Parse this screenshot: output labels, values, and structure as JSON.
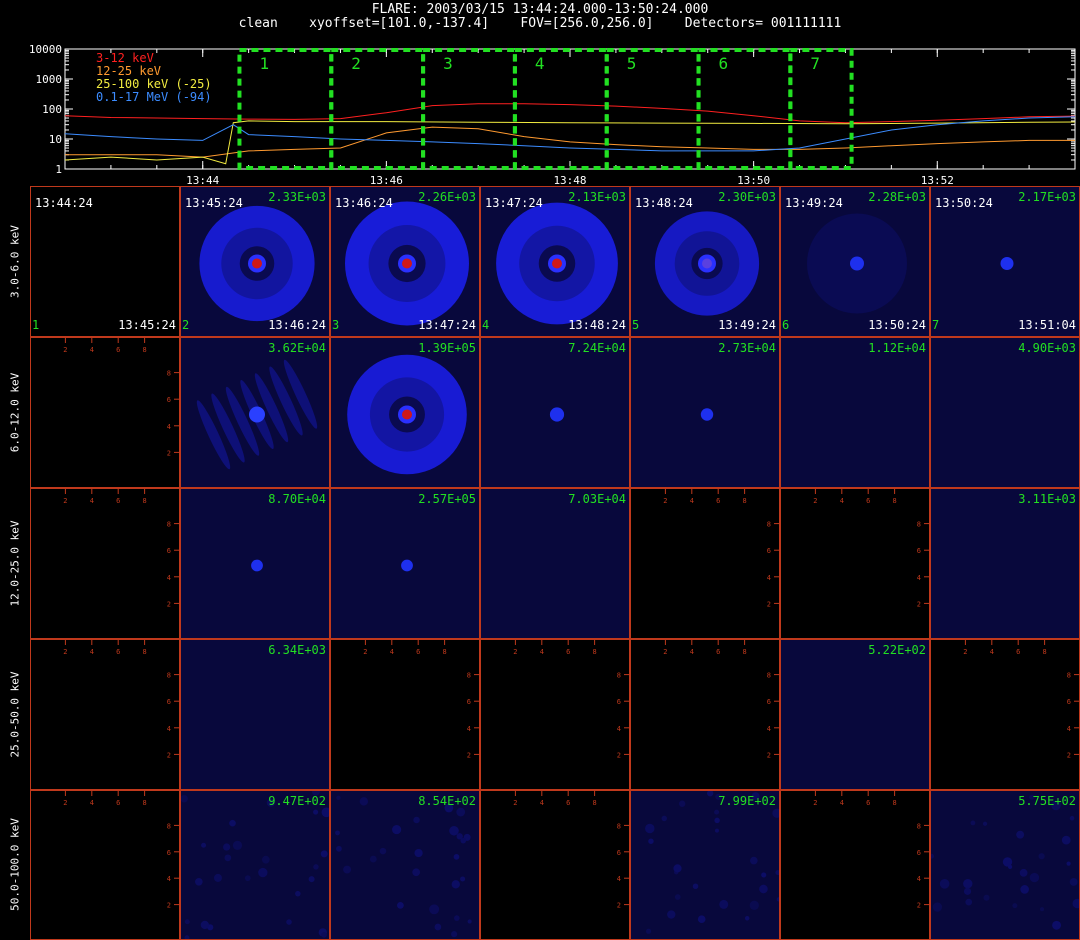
{
  "header": {
    "line1": "FLARE: 2003/03/15 13:44:24.000-13:50:24.000",
    "line2": "clean    xyoffset=[101.0,-137.4]    FOV=[256.0,256.0]    Detectors= 001111111"
  },
  "chart_data": [
    {
      "type": "line",
      "y_scale": "log",
      "ylim": [
        1,
        10000
      ],
      "y_tick_labels": [
        "1",
        "10",
        "100",
        "1000",
        "10000"
      ],
      "x_tick_labels": [
        "13:44",
        "13:46",
        "13:48",
        "13:50",
        "13:52"
      ],
      "x_range_minutes": [
        "13:42:30",
        "13:53:30"
      ],
      "legend": [
        {
          "label": "3-12 keV",
          "color": "#ff2020"
        },
        {
          "label": "12-25 keV",
          "color": "#ff9a30"
        },
        {
          "label": "25-100 keV (-25)",
          "color": "#f2ec40"
        },
        {
          "label": "0.1-17 MeV (-94)",
          "color": "#3c8cff"
        }
      ],
      "series": [
        {
          "name": "3-12 keV",
          "color": "#ff2020",
          "points": [
            [
              "13:42:30",
              60
            ],
            [
              "13:43:00",
              52
            ],
            [
              "13:43:30",
              50
            ],
            [
              "13:44:00",
              48
            ],
            [
              "13:44:30",
              46
            ],
            [
              "13:45:00",
              45
            ],
            [
              "13:45:30",
              48
            ],
            [
              "13:46:00",
              75
            ],
            [
              "13:46:30",
              130
            ],
            [
              "13:47:00",
              150
            ],
            [
              "13:47:30",
              150
            ],
            [
              "13:48:00",
              140
            ],
            [
              "13:48:30",
              125
            ],
            [
              "13:49:00",
              105
            ],
            [
              "13:49:30",
              85
            ],
            [
              "13:50:00",
              60
            ],
            [
              "13:50:30",
              40
            ],
            [
              "13:51:00",
              35
            ],
            [
              "13:51:30",
              38
            ],
            [
              "13:52:00",
              42
            ],
            [
              "13:52:30",
              48
            ],
            [
              "13:53:00",
              55
            ],
            [
              "13:53:30",
              58
            ]
          ]
        },
        {
          "name": "12-25 keV",
          "color": "#ff9a30",
          "points": [
            [
              "13:42:30",
              3
            ],
            [
              "13:43:00",
              3
            ],
            [
              "13:43:30",
              3
            ],
            [
              "13:44:00",
              2.5
            ],
            [
              "13:44:30",
              4
            ],
            [
              "13:45:00",
              4.5
            ],
            [
              "13:45:30",
              5
            ],
            [
              "13:46:00",
              16
            ],
            [
              "13:46:30",
              25
            ],
            [
              "13:47:00",
              22
            ],
            [
              "13:47:30",
              12
            ],
            [
              "13:48:00",
              8
            ],
            [
              "13:48:30",
              6.5
            ],
            [
              "13:49:00",
              5.5
            ],
            [
              "13:49:30",
              5
            ],
            [
              "13:50:00",
              4.5
            ],
            [
              "13:50:30",
              4.5
            ],
            [
              "13:51:00",
              5
            ],
            [
              "13:51:30",
              6
            ],
            [
              "13:52:00",
              7
            ],
            [
              "13:52:30",
              8
            ],
            [
              "13:53:00",
              9
            ],
            [
              "13:53:30",
              9
            ]
          ]
        },
        {
          "name": "25-100 keV (-25)",
          "color": "#f2ec40",
          "points": [
            [
              "13:42:30",
              2
            ],
            [
              "13:43:00",
              2.5
            ],
            [
              "13:43:30",
              2
            ],
            [
              "13:44:00",
              2.5
            ],
            [
              "13:44:15",
              1.5
            ],
            [
              "13:44:20",
              35
            ],
            [
              "13:44:30",
              40
            ],
            [
              "13:45:00",
              38
            ],
            [
              "13:46:00",
              38
            ],
            [
              "13:47:00",
              36
            ],
            [
              "13:48:00",
              35
            ],
            [
              "13:49:00",
              34
            ],
            [
              "13:50:00",
              33
            ],
            [
              "13:51:00",
              32
            ],
            [
              "13:52:00",
              34
            ],
            [
              "13:53:00",
              36
            ],
            [
              "13:53:30",
              37
            ]
          ]
        },
        {
          "name": "0.1-17 MeV (-94)",
          "color": "#3c8cff",
          "points": [
            [
              "13:42:30",
              15
            ],
            [
              "13:43:00",
              12
            ],
            [
              "13:43:30",
              10
            ],
            [
              "13:44:00",
              9
            ],
            [
              "13:44:20",
              30
            ],
            [
              "13:44:30",
              14
            ],
            [
              "13:45:00",
              12
            ],
            [
              "13:45:30",
              10
            ],
            [
              "13:46:00",
              9
            ],
            [
              "13:46:30",
              8
            ],
            [
              "13:47:00",
              7
            ],
            [
              "13:47:30",
              6
            ],
            [
              "13:48:00",
              5
            ],
            [
              "13:48:30",
              4.5
            ],
            [
              "13:49:00",
              4
            ],
            [
              "13:49:30",
              4
            ],
            [
              "13:50:00",
              4
            ],
            [
              "13:50:30",
              5
            ],
            [
              "13:51:00",
              10
            ],
            [
              "13:51:30",
              20
            ],
            [
              "13:52:00",
              30
            ],
            [
              "13:52:30",
              40
            ],
            [
              "13:53:00",
              50
            ],
            [
              "13:53:30",
              55
            ]
          ]
        }
      ],
      "intervals": [
        {
          "label": "1",
          "start": "13:44:24",
          "end": "13:45:24"
        },
        {
          "label": "2",
          "start": "13:45:24",
          "end": "13:46:24"
        },
        {
          "label": "3",
          "start": "13:46:24",
          "end": "13:47:24"
        },
        {
          "label": "4",
          "start": "13:47:24",
          "end": "13:48:24"
        },
        {
          "label": "5",
          "start": "13:48:24",
          "end": "13:49:24"
        },
        {
          "label": "6",
          "start": "13:49:24",
          "end": "13:50:24"
        },
        {
          "label": "7",
          "start": "13:50:24",
          "end": "13:51:04"
        }
      ]
    },
    {
      "type": "heatmap",
      "row_labels": [
        "3.0-6.0 keV",
        "6.0-12.0 keV",
        "12.0-25.0 keV",
        "25.0-50.0 keV",
        "50.0-100.0 keV"
      ],
      "column_start_times": [
        "13:44:24",
        "13:45:24",
        "13:46:24",
        "13:47:24",
        "13:48:24",
        "13:49:24",
        "13:50:24"
      ],
      "column_end_times": [
        "13:45:24",
        "13:46:24",
        "13:47:24",
        "13:48:24",
        "13:49:24",
        "13:50:24",
        "13:51:04"
      ],
      "column_index_labels": [
        "1",
        "2",
        "3",
        "4",
        "5",
        "6",
        "7"
      ],
      "empty_axis_tick_labels": [
        "2",
        "4",
        "6",
        "8"
      ],
      "cells": [
        [
          {
            "v": null
          },
          {
            "v": "2.33E+03",
            "kind": "ring",
            "intensity": 0.8
          },
          {
            "v": "2.26E+03",
            "kind": "ring",
            "intensity": 1.0
          },
          {
            "v": "2.13E+03",
            "kind": "ring",
            "intensity": 0.95
          },
          {
            "v": "2.30E+03",
            "kind": "ring",
            "intensity": 0.55
          },
          {
            "v": "2.28E+03",
            "kind": "faint",
            "intensity": 0.3
          },
          {
            "v": "2.17E+03",
            "kind": "dot",
            "intensity": 0.25
          }
        ],
        [
          {
            "v": null
          },
          {
            "v": "3.62E+04",
            "kind": "stripes",
            "intensity": 0.5
          },
          {
            "v": "1.39E+05",
            "kind": "ring",
            "intensity": 0.9
          },
          {
            "v": "7.24E+04",
            "kind": "dot",
            "intensity": 0.35
          },
          {
            "v": "2.73E+04",
            "kind": "dot",
            "intensity": 0.2
          },
          {
            "v": "1.12E+04",
            "kind": "flat",
            "intensity": 0.15
          },
          {
            "v": "4.90E+03",
            "kind": "flat",
            "intensity": 0.15
          }
        ],
        [
          {
            "v": null
          },
          {
            "v": "8.70E+04",
            "kind": "dot",
            "intensity": 0.15
          },
          {
            "v": "2.57E+05",
            "kind": "dot",
            "intensity": 0.15
          },
          {
            "v": "7.03E+04",
            "kind": "flat",
            "intensity": 0.15
          },
          {
            "v": null
          },
          {
            "v": null
          },
          {
            "v": "3.11E+03",
            "kind": "flat",
            "intensity": 0.15
          }
        ],
        [
          {
            "v": null
          },
          {
            "v": "6.34E+03",
            "kind": "flat",
            "intensity": 0.15
          },
          {
            "v": null
          },
          {
            "v": null
          },
          {
            "v": null
          },
          {
            "v": "5.22E+02",
            "kind": "flat",
            "intensity": 0.15
          },
          {
            "v": null
          }
        ],
        [
          {
            "v": null
          },
          {
            "v": "9.47E+02",
            "kind": "noise",
            "intensity": 0.15
          },
          {
            "v": "8.54E+02",
            "kind": "noise",
            "intensity": 0.2
          },
          {
            "v": null
          },
          {
            "v": "7.99E+02",
            "kind": "noise",
            "intensity": 0.15
          },
          {
            "v": null
          },
          {
            "v": "5.75E+02",
            "kind": "noise",
            "intensity": 0.25
          }
        ]
      ]
    }
  ]
}
